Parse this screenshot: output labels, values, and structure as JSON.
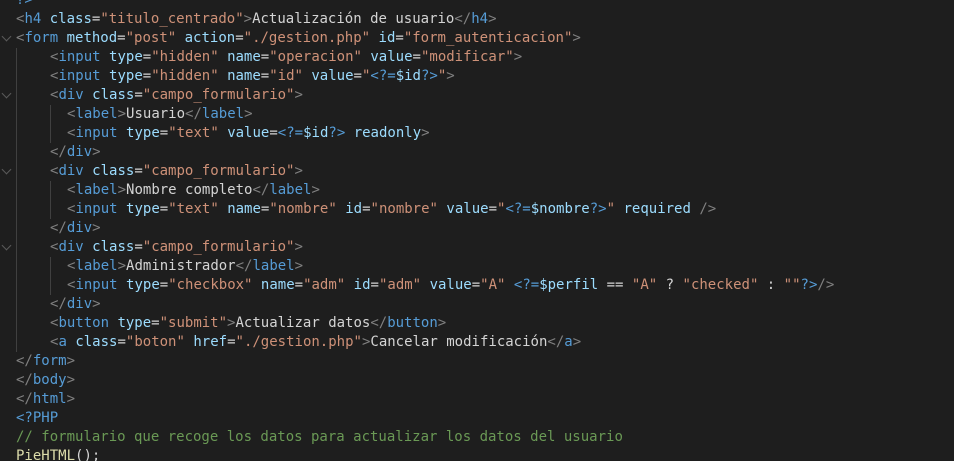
{
  "editor": {
    "language": "php",
    "theme_colors": {
      "background": "#1e1e1e",
      "tag": "#569cd6",
      "punctuation": "#808080",
      "attribute": "#9cdcfe",
      "string": "#ce9178",
      "text": "#d4d4d4",
      "comment": "#6a9955",
      "function": "#dcdcaa"
    },
    "lines": [
      {
        "indent": 0,
        "fold": false,
        "tokens": [
          {
            "t": "?>",
            "c": "tag"
          }
        ]
      },
      {
        "indent": 0,
        "fold": false,
        "tokens": [
          {
            "t": "<",
            "c": "punct"
          },
          {
            "t": "h4",
            "c": "tag"
          },
          {
            "t": " ",
            "c": "text"
          },
          {
            "t": "class",
            "c": "attr"
          },
          {
            "t": "=",
            "c": "text"
          },
          {
            "t": "\"titulo_centrado\"",
            "c": "str"
          },
          {
            "t": ">",
            "c": "punct"
          },
          {
            "t": "Actualización de usuario",
            "c": "text"
          },
          {
            "t": "</",
            "c": "punct"
          },
          {
            "t": "h4",
            "c": "tag"
          },
          {
            "t": ">",
            "c": "punct"
          }
        ]
      },
      {
        "indent": 0,
        "fold": true,
        "tokens": [
          {
            "t": "<",
            "c": "punct"
          },
          {
            "t": "form",
            "c": "tag"
          },
          {
            "t": " ",
            "c": "text"
          },
          {
            "t": "method",
            "c": "attr"
          },
          {
            "t": "=",
            "c": "text"
          },
          {
            "t": "\"post\"",
            "c": "str"
          },
          {
            "t": " ",
            "c": "text"
          },
          {
            "t": "action",
            "c": "attr"
          },
          {
            "t": "=",
            "c": "text"
          },
          {
            "t": "\"./gestion.php\"",
            "c": "str"
          },
          {
            "t": " ",
            "c": "text"
          },
          {
            "t": "id",
            "c": "attr"
          },
          {
            "t": "=",
            "c": "text"
          },
          {
            "t": "\"form_autenticacion\"",
            "c": "str"
          },
          {
            "t": ">",
            "c": "punct"
          }
        ]
      },
      {
        "indent": 1,
        "fold": false,
        "tokens": [
          {
            "t": "<",
            "c": "punct"
          },
          {
            "t": "input",
            "c": "tag"
          },
          {
            "t": " ",
            "c": "text"
          },
          {
            "t": "type",
            "c": "attr"
          },
          {
            "t": "=",
            "c": "text"
          },
          {
            "t": "\"hidden\"",
            "c": "str"
          },
          {
            "t": " ",
            "c": "text"
          },
          {
            "t": "name",
            "c": "attr"
          },
          {
            "t": "=",
            "c": "text"
          },
          {
            "t": "\"operacion\"",
            "c": "str"
          },
          {
            "t": " ",
            "c": "text"
          },
          {
            "t": "value",
            "c": "attr"
          },
          {
            "t": "=",
            "c": "text"
          },
          {
            "t": "\"modificar\"",
            "c": "str"
          },
          {
            "t": ">",
            "c": "punct"
          }
        ]
      },
      {
        "indent": 1,
        "fold": false,
        "tokens": [
          {
            "t": "<",
            "c": "punct"
          },
          {
            "t": "input",
            "c": "tag"
          },
          {
            "t": " ",
            "c": "text"
          },
          {
            "t": "type",
            "c": "attr"
          },
          {
            "t": "=",
            "c": "text"
          },
          {
            "t": "\"hidden\"",
            "c": "str"
          },
          {
            "t": " ",
            "c": "text"
          },
          {
            "t": "name",
            "c": "attr"
          },
          {
            "t": "=",
            "c": "text"
          },
          {
            "t": "\"id\"",
            "c": "str"
          },
          {
            "t": " ",
            "c": "text"
          },
          {
            "t": "value",
            "c": "attr"
          },
          {
            "t": "=",
            "c": "text"
          },
          {
            "t": "\"",
            "c": "str"
          },
          {
            "t": "<?=",
            "c": "tag"
          },
          {
            "t": "$id",
            "c": "attr"
          },
          {
            "t": "?>",
            "c": "tag"
          },
          {
            "t": "\"",
            "c": "str"
          },
          {
            "t": ">",
            "c": "punct"
          }
        ]
      },
      {
        "indent": 1,
        "fold": true,
        "tokens": [
          {
            "t": "<",
            "c": "punct"
          },
          {
            "t": "div",
            "c": "tag"
          },
          {
            "t": " ",
            "c": "text"
          },
          {
            "t": "class",
            "c": "attr"
          },
          {
            "t": "=",
            "c": "text"
          },
          {
            "t": "\"campo_formulario\"",
            "c": "str"
          },
          {
            "t": ">",
            "c": "punct"
          }
        ]
      },
      {
        "indent": 2,
        "fold": false,
        "tokens": [
          {
            "t": "<",
            "c": "punct"
          },
          {
            "t": "label",
            "c": "tag"
          },
          {
            "t": ">",
            "c": "punct"
          },
          {
            "t": "Usuario",
            "c": "text"
          },
          {
            "t": "</",
            "c": "punct"
          },
          {
            "t": "label",
            "c": "tag"
          },
          {
            "t": ">",
            "c": "punct"
          }
        ]
      },
      {
        "indent": 2,
        "fold": false,
        "tokens": [
          {
            "t": "<",
            "c": "punct"
          },
          {
            "t": "input",
            "c": "tag"
          },
          {
            "t": " ",
            "c": "text"
          },
          {
            "t": "type",
            "c": "attr"
          },
          {
            "t": "=",
            "c": "text"
          },
          {
            "t": "\"text\"",
            "c": "str"
          },
          {
            "t": " ",
            "c": "text"
          },
          {
            "t": "value",
            "c": "attr"
          },
          {
            "t": "=",
            "c": "text"
          },
          {
            "t": "<?=",
            "c": "tag"
          },
          {
            "t": "$id",
            "c": "attr"
          },
          {
            "t": "?>",
            "c": "tag"
          },
          {
            "t": " ",
            "c": "text"
          },
          {
            "t": "readonly",
            "c": "attr"
          },
          {
            "t": ">",
            "c": "punct"
          }
        ]
      },
      {
        "indent": 1,
        "fold": false,
        "tokens": [
          {
            "t": "</",
            "c": "punct"
          },
          {
            "t": "div",
            "c": "tag"
          },
          {
            "t": ">",
            "c": "punct"
          }
        ]
      },
      {
        "indent": 1,
        "fold": true,
        "tokens": [
          {
            "t": "<",
            "c": "punct"
          },
          {
            "t": "div",
            "c": "tag"
          },
          {
            "t": " ",
            "c": "text"
          },
          {
            "t": "class",
            "c": "attr"
          },
          {
            "t": "=",
            "c": "text"
          },
          {
            "t": "\"campo_formulario\"",
            "c": "str"
          },
          {
            "t": ">",
            "c": "punct"
          }
        ]
      },
      {
        "indent": 2,
        "fold": false,
        "tokens": [
          {
            "t": "<",
            "c": "punct"
          },
          {
            "t": "label",
            "c": "tag"
          },
          {
            "t": ">",
            "c": "punct"
          },
          {
            "t": "Nombre completo",
            "c": "text"
          },
          {
            "t": "</",
            "c": "punct"
          },
          {
            "t": "label",
            "c": "tag"
          },
          {
            "t": ">",
            "c": "punct"
          }
        ]
      },
      {
        "indent": 2,
        "fold": false,
        "tokens": [
          {
            "t": "<",
            "c": "punct"
          },
          {
            "t": "input",
            "c": "tag"
          },
          {
            "t": " ",
            "c": "text"
          },
          {
            "t": "type",
            "c": "attr"
          },
          {
            "t": "=",
            "c": "text"
          },
          {
            "t": "\"text\"",
            "c": "str"
          },
          {
            "t": " ",
            "c": "text"
          },
          {
            "t": "name",
            "c": "attr"
          },
          {
            "t": "=",
            "c": "text"
          },
          {
            "t": "\"nombre\"",
            "c": "str"
          },
          {
            "t": " ",
            "c": "text"
          },
          {
            "t": "id",
            "c": "attr"
          },
          {
            "t": "=",
            "c": "text"
          },
          {
            "t": "\"nombre\"",
            "c": "str"
          },
          {
            "t": " ",
            "c": "text"
          },
          {
            "t": "value",
            "c": "attr"
          },
          {
            "t": "=",
            "c": "text"
          },
          {
            "t": "\"",
            "c": "str"
          },
          {
            "t": "<?=",
            "c": "tag"
          },
          {
            "t": "$nombre",
            "c": "attr"
          },
          {
            "t": "?>",
            "c": "tag"
          },
          {
            "t": "\"",
            "c": "str"
          },
          {
            "t": " ",
            "c": "text"
          },
          {
            "t": "required",
            "c": "attr"
          },
          {
            "t": " ",
            "c": "text"
          },
          {
            "t": "/>",
            "c": "punct"
          }
        ]
      },
      {
        "indent": 1,
        "fold": false,
        "tokens": [
          {
            "t": "</",
            "c": "punct"
          },
          {
            "t": "div",
            "c": "tag"
          },
          {
            "t": ">",
            "c": "punct"
          }
        ]
      },
      {
        "indent": 1,
        "fold": true,
        "tokens": [
          {
            "t": "<",
            "c": "punct"
          },
          {
            "t": "div",
            "c": "tag"
          },
          {
            "t": " ",
            "c": "text"
          },
          {
            "t": "class",
            "c": "attr"
          },
          {
            "t": "=",
            "c": "text"
          },
          {
            "t": "\"campo_formulario\"",
            "c": "str"
          },
          {
            "t": ">",
            "c": "punct"
          }
        ]
      },
      {
        "indent": 2,
        "fold": false,
        "tokens": [
          {
            "t": "<",
            "c": "punct"
          },
          {
            "t": "label",
            "c": "tag"
          },
          {
            "t": ">",
            "c": "punct"
          },
          {
            "t": "Administrador",
            "c": "text"
          },
          {
            "t": "</",
            "c": "punct"
          },
          {
            "t": "label",
            "c": "tag"
          },
          {
            "t": ">",
            "c": "punct"
          }
        ]
      },
      {
        "indent": 2,
        "fold": false,
        "tokens": [
          {
            "t": "<",
            "c": "punct"
          },
          {
            "t": "input",
            "c": "tag"
          },
          {
            "t": " ",
            "c": "text"
          },
          {
            "t": "type",
            "c": "attr"
          },
          {
            "t": "=",
            "c": "text"
          },
          {
            "t": "\"checkbox\"",
            "c": "str"
          },
          {
            "t": " ",
            "c": "text"
          },
          {
            "t": "name",
            "c": "attr"
          },
          {
            "t": "=",
            "c": "text"
          },
          {
            "t": "\"adm\"",
            "c": "str"
          },
          {
            "t": " ",
            "c": "text"
          },
          {
            "t": "id",
            "c": "attr"
          },
          {
            "t": "=",
            "c": "text"
          },
          {
            "t": "\"adm\"",
            "c": "str"
          },
          {
            "t": " ",
            "c": "text"
          },
          {
            "t": "value",
            "c": "attr"
          },
          {
            "t": "=",
            "c": "text"
          },
          {
            "t": "\"A\"",
            "c": "str"
          },
          {
            "t": " ",
            "c": "text"
          },
          {
            "t": "<?=",
            "c": "tag"
          },
          {
            "t": "$perfil",
            "c": "attr"
          },
          {
            "t": " == ",
            "c": "text"
          },
          {
            "t": "\"A\"",
            "c": "str"
          },
          {
            "t": " ? ",
            "c": "text"
          },
          {
            "t": "\"checked\"",
            "c": "str"
          },
          {
            "t": " : ",
            "c": "text"
          },
          {
            "t": "\"\"",
            "c": "str"
          },
          {
            "t": "?>",
            "c": "tag"
          },
          {
            "t": "/>",
            "c": "punct"
          }
        ]
      },
      {
        "indent": 1,
        "fold": false,
        "tokens": [
          {
            "t": "</",
            "c": "punct"
          },
          {
            "t": "div",
            "c": "tag"
          },
          {
            "t": ">",
            "c": "punct"
          }
        ]
      },
      {
        "indent": 1,
        "fold": false,
        "tokens": [
          {
            "t": "<",
            "c": "punct"
          },
          {
            "t": "button",
            "c": "tag"
          },
          {
            "t": " ",
            "c": "text"
          },
          {
            "t": "type",
            "c": "attr"
          },
          {
            "t": "=",
            "c": "text"
          },
          {
            "t": "\"submit\"",
            "c": "str"
          },
          {
            "t": ">",
            "c": "punct"
          },
          {
            "t": "Actualizar datos",
            "c": "text"
          },
          {
            "t": "</",
            "c": "punct"
          },
          {
            "t": "button",
            "c": "tag"
          },
          {
            "t": ">",
            "c": "punct"
          }
        ]
      },
      {
        "indent": 1,
        "fold": false,
        "tokens": [
          {
            "t": "<",
            "c": "punct"
          },
          {
            "t": "a",
            "c": "tag"
          },
          {
            "t": " ",
            "c": "text"
          },
          {
            "t": "class",
            "c": "attr"
          },
          {
            "t": "=",
            "c": "text"
          },
          {
            "t": "\"boton\"",
            "c": "str"
          },
          {
            "t": " ",
            "c": "text"
          },
          {
            "t": "href",
            "c": "attr"
          },
          {
            "t": "=",
            "c": "text"
          },
          {
            "t": "\"./gestion.php\"",
            "c": "str"
          },
          {
            "t": ">",
            "c": "punct"
          },
          {
            "t": "Cancelar modificación",
            "c": "text"
          },
          {
            "t": "</",
            "c": "punct"
          },
          {
            "t": "a",
            "c": "tag"
          },
          {
            "t": ">",
            "c": "punct"
          }
        ]
      },
      {
        "indent": 0,
        "fold": false,
        "tokens": [
          {
            "t": "</",
            "c": "punct"
          },
          {
            "t": "form",
            "c": "tag"
          },
          {
            "t": ">",
            "c": "punct"
          }
        ]
      },
      {
        "indent": 0,
        "fold": false,
        "tokens": [
          {
            "t": "</",
            "c": "punct"
          },
          {
            "t": "body",
            "c": "tag"
          },
          {
            "t": ">",
            "c": "punct"
          }
        ]
      },
      {
        "indent": 0,
        "fold": false,
        "tokens": [
          {
            "t": "</",
            "c": "punct"
          },
          {
            "t": "html",
            "c": "tag"
          },
          {
            "t": ">",
            "c": "punct"
          }
        ]
      },
      {
        "indent": 0,
        "fold": false,
        "tokens": [
          {
            "t": "<?PHP",
            "c": "tag"
          }
        ]
      },
      {
        "indent": 0,
        "fold": false,
        "tokens": [
          {
            "t": "// formulario que recoge los datos para actualizar los datos del usuario",
            "c": "comment"
          }
        ]
      },
      {
        "indent": 0,
        "fold": false,
        "tokens": [
          {
            "t": "PieHTML",
            "c": "func"
          },
          {
            "t": "();",
            "c": "text"
          }
        ]
      }
    ]
  }
}
